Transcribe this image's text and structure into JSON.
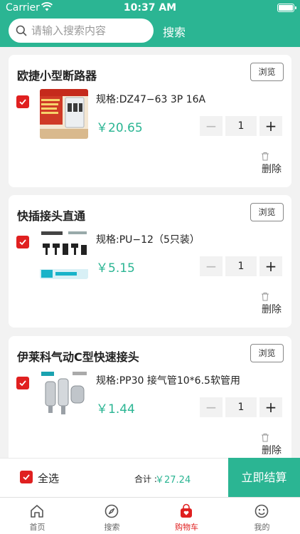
{
  "status_bar": {
    "carrier": "Carrier",
    "time": "10:37 AM"
  },
  "search": {
    "placeholder": "请输入搜索内容",
    "button_label": "搜索"
  },
  "cart": {
    "browse_label": "浏览",
    "delete_label": "删除",
    "items": [
      {
        "title": "欧捷小型断路器",
        "spec": "规格:DZ47−63 3P 16A",
        "price": "￥20.65",
        "quantity": "1",
        "checked": true
      },
      {
        "title": "快插接头直通",
        "spec": "规格:PU−12（5只装）",
        "price": "￥5.15",
        "quantity": "1",
        "checked": true
      },
      {
        "title": "伊莱科气动C型快速接头",
        "spec": "规格:PP30 接气管10*6.5软管用",
        "price": "￥1.44",
        "quantity": "1",
        "checked": true
      }
    ]
  },
  "footer": {
    "select_all_label": "全选",
    "total_label": "合计 :",
    "total_value": "￥27.24",
    "checkout_label": "立即结算"
  },
  "tabs": [
    {
      "label": "首页",
      "icon": "home-icon",
      "active": false
    },
    {
      "label": "搜索",
      "icon": "compass-icon",
      "active": false
    },
    {
      "label": "购物车",
      "icon": "cart-bag-icon",
      "active": true
    },
    {
      "label": "我的",
      "icon": "smiley-icon",
      "active": false
    }
  ],
  "colors": {
    "brand": "#2bb593",
    "accent_red": "#e02020"
  }
}
